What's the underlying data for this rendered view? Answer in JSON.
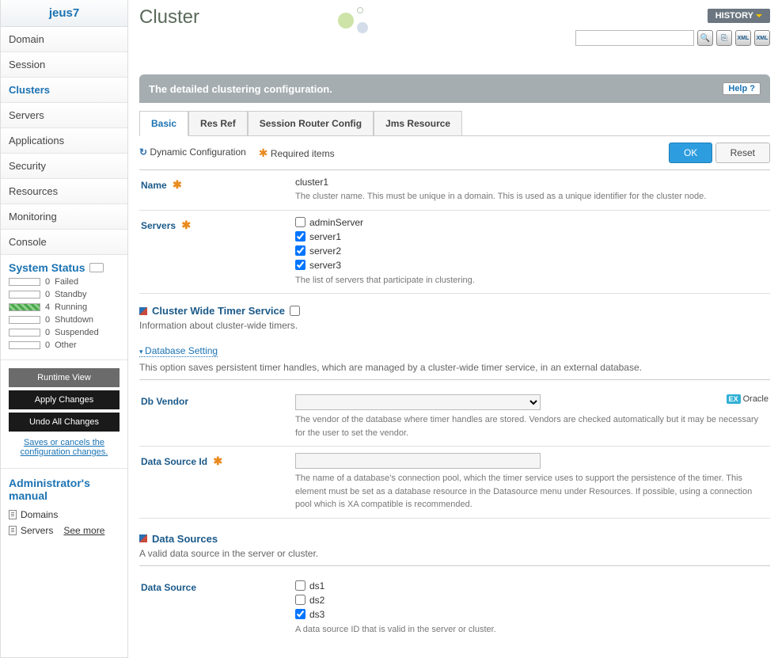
{
  "brand": "jeus7",
  "nav": [
    "Domain",
    "Session",
    "Clusters",
    "Servers",
    "Applications",
    "Security",
    "Resources",
    "Monitoring",
    "Console"
  ],
  "activeNav": 2,
  "systemStatus": {
    "title": "System Status",
    "rows": [
      {
        "count": 0,
        "label": "Failed",
        "green": false
      },
      {
        "count": 0,
        "label": "Standby",
        "green": false
      },
      {
        "count": 4,
        "label": "Running",
        "green": true
      },
      {
        "count": 0,
        "label": "Shutdown",
        "green": false
      },
      {
        "count": 0,
        "label": "Suspended",
        "green": false
      },
      {
        "count": 0,
        "label": "Other",
        "green": false
      }
    ]
  },
  "actionButtons": {
    "runtime": "Runtime View",
    "apply": "Apply Changes",
    "undo": "Undo All Changes",
    "note": "Saves or cancels the configuration changes."
  },
  "manual": {
    "title": "Administrator's manual",
    "items": [
      "Domains",
      "Servers"
    ],
    "seeMore": "See more"
  },
  "page": {
    "title": "Cluster",
    "history": "HISTORY",
    "descBar": "The detailed clustering configuration.",
    "help": "Help  ?"
  },
  "tabs": [
    "Basic",
    "Res Ref",
    "Session Router Config",
    "Jms Resource"
  ],
  "activeTab": 0,
  "legend": {
    "dyn": "Dynamic Configuration",
    "req": "Required items"
  },
  "buttons": {
    "ok": "OK",
    "reset": "Reset"
  },
  "form": {
    "name": {
      "label": "Name",
      "value": "cluster1",
      "help": "The cluster name. This must be unique in a domain. This is used as a unique identifier for the cluster node."
    },
    "servers": {
      "label": "Servers",
      "items": [
        {
          "label": "adminServer",
          "checked": false
        },
        {
          "label": "server1",
          "checked": true
        },
        {
          "label": "server2",
          "checked": true
        },
        {
          "label": "server3",
          "checked": true
        }
      ],
      "help": "The list of servers that participate in clustering."
    },
    "timerSection": {
      "title": "Cluster Wide Timer Service",
      "sub": "Information about cluster-wide timers."
    },
    "dbSetting": {
      "collapse": "Database Setting",
      "sub": "This option saves persistent timer handles, which are managed by a cluster-wide timer service, in an external database."
    },
    "dbVendor": {
      "label": "Db Vendor",
      "example": "Oracle",
      "help": "The vendor of the database where timer handles are stored. Vendors are checked automatically but it may be necessary for the user to set the vendor."
    },
    "dsId": {
      "label": "Data Source Id",
      "help": "The name of a database's connection pool, which the timer service uses to support the persistence of the timer. This element must be set as a database resource in the Datasource menu under Resources. If possible, using a connection pool which is XA compatible is recommended."
    },
    "dataSourcesSection": {
      "title": "Data Sources",
      "sub": "A valid data source in the server or cluster."
    },
    "dataSource": {
      "label": "Data Source",
      "items": [
        {
          "label": "ds1",
          "checked": false
        },
        {
          "label": "ds2",
          "checked": false
        },
        {
          "label": "ds3",
          "checked": true
        }
      ],
      "help": "A data source ID that is valid in the server or cluster."
    }
  }
}
